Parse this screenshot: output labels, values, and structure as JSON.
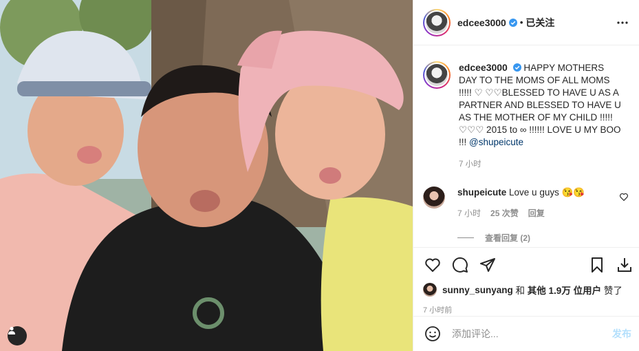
{
  "header": {
    "username": "edcee3000",
    "separator": "•",
    "follow_state": "已关注"
  },
  "caption": {
    "username": "edcee3000",
    "text": "HAPPY MOTHERS DAY TO THE MOMS OF ALL MOMS !!!!! ♡ ♡♡BLESSED TO HAVE U AS A PARTNER AND BLESSED TO HAVE U AS THE MOTHER OF MY CHILD !!!!! ♡♡♡ 2015 to ∞ !!!!!! LOVE U MY BOO !!! ",
    "mention": "@shupeicute",
    "time": "7 小时"
  },
  "reply": {
    "username": "shupeicute",
    "text": "Love u guys 😘😘",
    "time": "7 小时",
    "likes": "25 次赞",
    "reply_label": "回复",
    "view_replies": "查看回复 (2)"
  },
  "likes": {
    "first_liker": "sunny_sunyang",
    "connector": " 和 ",
    "others": "其他 1.9万 位用户",
    "suffix": " 赞了"
  },
  "post_time": "7 小时前",
  "add_comment": {
    "placeholder": "添加评论...",
    "post_label": "发布"
  },
  "icons": {
    "header_more": "more-horizontal-icon",
    "like": "heart-icon",
    "comment": "comment-icon",
    "share": "paper-plane-icon",
    "save": "bookmark-icon",
    "download": "download-icon",
    "emoji": "smiley-icon",
    "tag": "person-tag-icon",
    "verified": "verified-badge-icon"
  },
  "colors": {
    "verified": "#3897f0",
    "mention": "#00376b",
    "post_button_disabled": "#b2dffc",
    "secondary_text": "#8e8e8e"
  }
}
